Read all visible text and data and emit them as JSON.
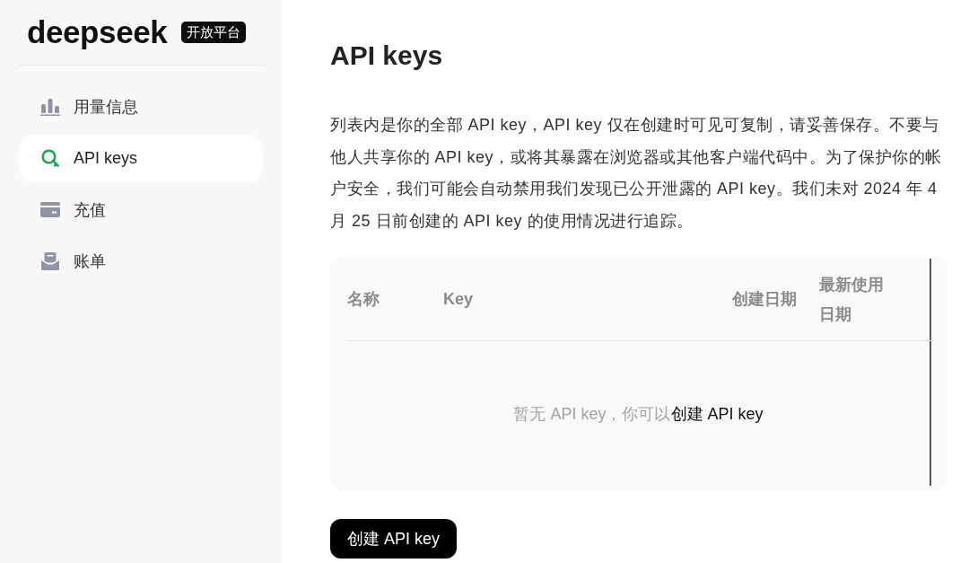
{
  "sidebar": {
    "logo": {
      "wordmark": "deepseek",
      "badge": "开放平台"
    },
    "items": [
      {
        "label": "用量信息",
        "selected": false
      },
      {
        "label": "API keys",
        "selected": true
      },
      {
        "label": "充值",
        "selected": false
      },
      {
        "label": "账单",
        "selected": false
      }
    ]
  },
  "main": {
    "title": "API keys",
    "description": "列表内是你的全部 API key，API key 仅在创建时可见可复制，请妥善保存。不要与他人共享你的 API key，或将其暴露在浏览器或其他客户端代码中。为了保护你的帐户安全，我们可能会自动禁用我们发现已公开泄露的 API key。我们未对 2024 年 4 月 25 日前创建的 API key 的使用情况进行追踪。",
    "table": {
      "columns": [
        "名称",
        "Key",
        "创建日期",
        "最新使用日期"
      ],
      "empty": {
        "text": "暂无 API key，你可以",
        "link": "创建 API key"
      }
    },
    "create_button": "创建 API key"
  }
}
